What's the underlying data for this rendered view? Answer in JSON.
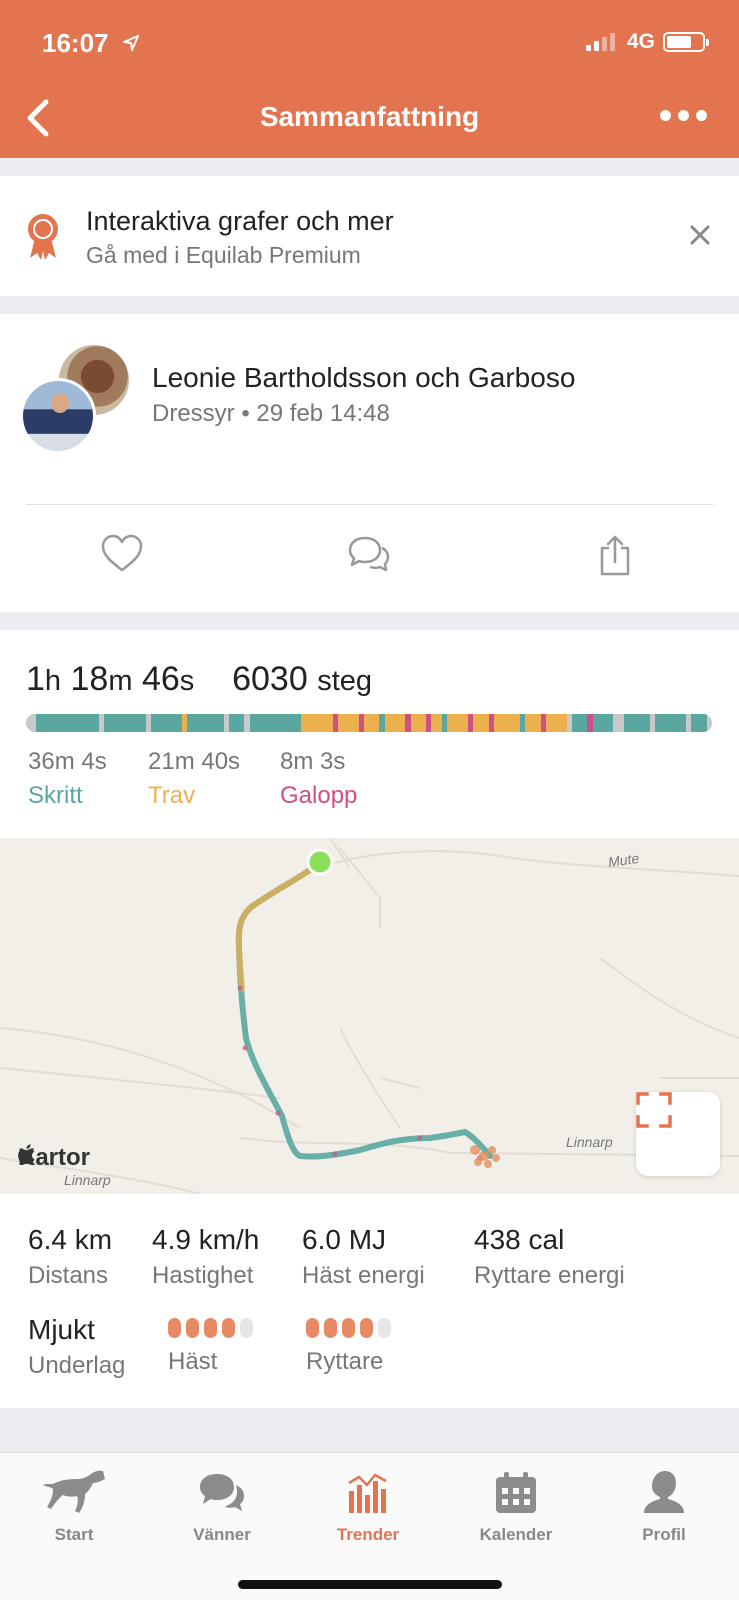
{
  "status_bar": {
    "time": "16:07",
    "network": "4G"
  },
  "nav": {
    "title": "Sammanfattning"
  },
  "premium_banner": {
    "title": "Interaktiva grafer och mer",
    "subtitle": "Gå med i Equilab Premium"
  },
  "activity": {
    "name": "Leonie Bartholdsson och Garboso",
    "type": "Dressyr",
    "date": "29 feb 14:48"
  },
  "summary": {
    "hours": "1",
    "hours_unit": "h",
    "minutes": "18",
    "minutes_unit": "m",
    "seconds": "46",
    "seconds_unit": "s",
    "steps": "6030",
    "steps_unit": "steg",
    "gaits": [
      {
        "time": "36m 4s",
        "label": "Skritt",
        "color": "#5aa7a0"
      },
      {
        "time": "21m 40s",
        "label": "Trav",
        "color": "#ecb04e"
      },
      {
        "time": "8m 3s",
        "label": "Galopp",
        "color": "#cf4f86"
      }
    ]
  },
  "map": {
    "brand": "Kartor",
    "labels": [
      "Mute",
      "Linnarp",
      "Linnarp"
    ]
  },
  "metrics": [
    {
      "value": "6.4 km",
      "label": "Distans"
    },
    {
      "value": "4.9 km/h",
      "label": "Hastighet"
    },
    {
      "value": "6.0 MJ",
      "label": "Häst energi"
    },
    {
      "value": "438 cal",
      "label": "Ryttare energi"
    }
  ],
  "ground": {
    "value": "Mjukt",
    "label": "Underlag",
    "horse_label": "Häst",
    "horse_level": 4,
    "horse_max": 5,
    "rider_label": "Ryttare",
    "rider_level": 4,
    "rider_max": 5
  },
  "colors": {
    "accent": "#e2744f",
    "walk": "#5aa7a0",
    "trot": "#ecb04e",
    "canter": "#cf4f86",
    "start_marker": "#8be05a"
  },
  "tabs": [
    {
      "label": "Start",
      "icon": "horse-icon"
    },
    {
      "label": "Vänner",
      "icon": "chat-bubbles-icon"
    },
    {
      "label": "Trender",
      "icon": "bar-chart-icon",
      "active": true
    },
    {
      "label": "Kalender",
      "icon": "calendar-icon"
    },
    {
      "label": "Profil",
      "icon": "person-icon"
    }
  ]
}
